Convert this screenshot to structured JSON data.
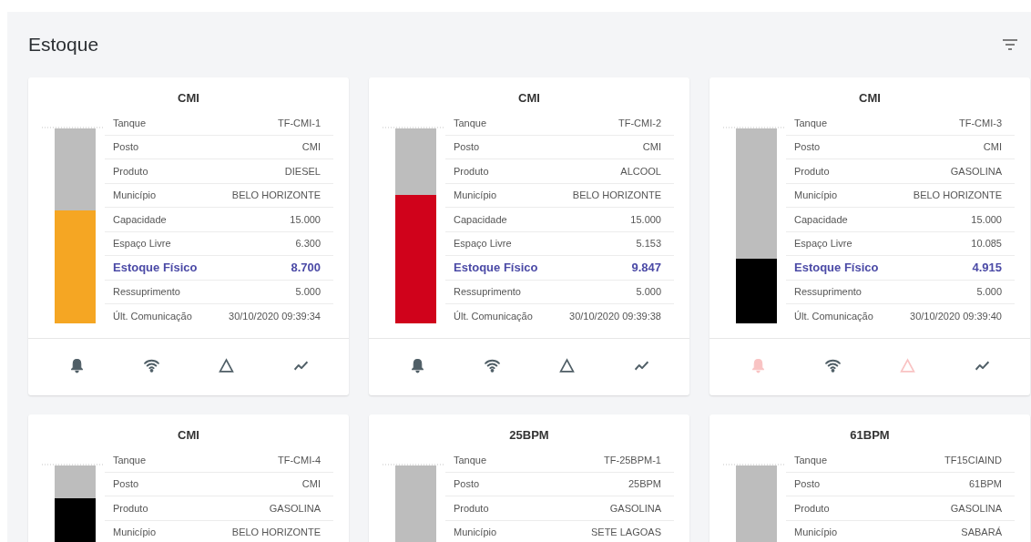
{
  "header": {
    "title": "Estoque"
  },
  "cards": [
    {
      "title": "CMI",
      "tank": {
        "level": 0.58,
        "color": "#f5a623"
      },
      "rows": [
        {
          "label": "Tanque",
          "value": "TF-CMI-1",
          "emphasis": false
        },
        {
          "label": "Posto",
          "value": "CMI",
          "emphasis": false
        },
        {
          "label": "Produto",
          "value": "DIESEL",
          "emphasis": false
        },
        {
          "label": "Município",
          "value": "BELO HORIZONTE",
          "emphasis": false
        },
        {
          "label": "Capacidade",
          "value": "15.000",
          "emphasis": false
        },
        {
          "label": "Espaço Livre",
          "value": "6.300",
          "emphasis": false
        },
        {
          "label": "Estoque Físico",
          "value": "8.700",
          "emphasis": true
        },
        {
          "label": "Ressuprimento",
          "value": "5.000",
          "emphasis": false
        },
        {
          "label": "Últ. Comunicação",
          "value": "30/10/2020 09:39:34",
          "emphasis": false
        }
      ],
      "actions": [
        {
          "kind": "bell",
          "alert": false
        },
        {
          "kind": "wifi",
          "alert": false
        },
        {
          "kind": "warning",
          "alert": false
        },
        {
          "kind": "trend",
          "alert": false
        }
      ]
    },
    {
      "title": "CMI",
      "tank": {
        "level": 0.66,
        "color": "#d0021b"
      },
      "rows": [
        {
          "label": "Tanque",
          "value": "TF-CMI-2",
          "emphasis": false
        },
        {
          "label": "Posto",
          "value": "CMI",
          "emphasis": false
        },
        {
          "label": "Produto",
          "value": "ALCOOL",
          "emphasis": false
        },
        {
          "label": "Município",
          "value": "BELO HORIZONTE",
          "emphasis": false
        },
        {
          "label": "Capacidade",
          "value": "15.000",
          "emphasis": false
        },
        {
          "label": "Espaço Livre",
          "value": "5.153",
          "emphasis": false
        },
        {
          "label": "Estoque Físico",
          "value": "9.847",
          "emphasis": true
        },
        {
          "label": "Ressuprimento",
          "value": "5.000",
          "emphasis": false
        },
        {
          "label": "Últ. Comunicação",
          "value": "30/10/2020 09:39:38",
          "emphasis": false
        }
      ],
      "actions": [
        {
          "kind": "bell",
          "alert": false
        },
        {
          "kind": "wifi",
          "alert": false
        },
        {
          "kind": "warning",
          "alert": false
        },
        {
          "kind": "trend",
          "alert": false
        }
      ]
    },
    {
      "title": "CMI",
      "tank": {
        "level": 0.33,
        "color": "#000000"
      },
      "rows": [
        {
          "label": "Tanque",
          "value": "TF-CMI-3",
          "emphasis": false
        },
        {
          "label": "Posto",
          "value": "CMI",
          "emphasis": false
        },
        {
          "label": "Produto",
          "value": "GASOLINA",
          "emphasis": false
        },
        {
          "label": "Município",
          "value": "BELO HORIZONTE",
          "emphasis": false
        },
        {
          "label": "Capacidade",
          "value": "15.000",
          "emphasis": false
        },
        {
          "label": "Espaço Livre",
          "value": "10.085",
          "emphasis": false
        },
        {
          "label": "Estoque Físico",
          "value": "4.915",
          "emphasis": true
        },
        {
          "label": "Ressuprimento",
          "value": "5.000",
          "emphasis": false
        },
        {
          "label": "Últ. Comunicação",
          "value": "30/10/2020 09:39:40",
          "emphasis": false
        }
      ],
      "actions": [
        {
          "kind": "bell",
          "alert": true
        },
        {
          "kind": "wifi",
          "alert": false
        },
        {
          "kind": "warning",
          "alert": true
        },
        {
          "kind": "trend",
          "alert": false
        }
      ]
    },
    {
      "title": "CMI",
      "tank": {
        "level": 0.83,
        "color": "#000000"
      },
      "rows": [
        {
          "label": "Tanque",
          "value": "TF-CMI-4",
          "emphasis": false
        },
        {
          "label": "Posto",
          "value": "CMI",
          "emphasis": false
        },
        {
          "label": "Produto",
          "value": "GASOLINA",
          "emphasis": false
        },
        {
          "label": "Município",
          "value": "BELO HORIZONTE",
          "emphasis": false
        }
      ]
    },
    {
      "title": "25BPM",
      "rows": [
        {
          "label": "Tanque",
          "value": "TF-25BPM-1",
          "emphasis": false
        },
        {
          "label": "Posto",
          "value": "25BPM",
          "emphasis": false
        },
        {
          "label": "Produto",
          "value": "GASOLINA",
          "emphasis": false
        },
        {
          "label": "Município",
          "value": "SETE LAGOAS",
          "emphasis": false
        }
      ]
    },
    {
      "title": "61BPM",
      "rows": [
        {
          "label": "Tanque",
          "value": "TF15CIAIND",
          "emphasis": false
        },
        {
          "label": "Posto",
          "value": "61BPM",
          "emphasis": false
        },
        {
          "label": "Produto",
          "value": "GASOLINA",
          "emphasis": false
        },
        {
          "label": "Município",
          "value": "SABARÁ",
          "emphasis": false
        }
      ]
    }
  ]
}
